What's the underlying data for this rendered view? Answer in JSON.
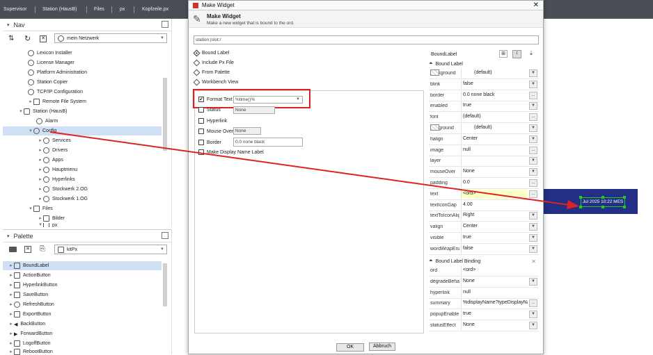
{
  "topbar": {
    "crumbs": [
      "Supervisor",
      "Station (HausB)",
      "Files",
      "px",
      "Kopfzeile.px"
    ]
  },
  "nav": {
    "title": "Nav",
    "network": "mein Netzwerk",
    "items": [
      "Lexicon Installer",
      "License Manager",
      "Platform Administration",
      "Station Copier",
      "TCP/IP Configuration",
      "Remote File System",
      "Station (HausB)",
      "Alarm",
      "Config",
      "Services",
      "Drivers",
      "Apps",
      "Hauptmenu",
      "Hyperlinks",
      "Stockwerk 2.OG",
      "Stockwerk 1.OG",
      "Files",
      "Bilder",
      "px"
    ]
  },
  "palette": {
    "title": "Palette",
    "module": "kitPx",
    "items": [
      "BoundLabel",
      "ActionButton",
      "HyperlinkButton",
      "SaveButton",
      "RefreshButton",
      "ExportButton",
      "BackButton",
      "ForwardButton",
      "LogoffButton",
      "RebootButton"
    ]
  },
  "dialog": {
    "title": "Make Widget",
    "heading": "Make Widget",
    "subheading": "Make a new widget that is bound to the ord.",
    "ord": "station:|slot:/",
    "options": [
      "Bound Label",
      "Include Px File",
      "From Palette",
      "Workbench View"
    ],
    "fields": {
      "format_text": {
        "label": "Format Text",
        "value": "%time()%"
      },
      "status": {
        "label": "Status",
        "value": "None"
      },
      "hyperlink": {
        "label": "Hyperlink"
      },
      "mouse_over": {
        "label": "Mouse Over",
        "value": "None"
      },
      "border": {
        "label": "Border",
        "value": "0.0 none black"
      },
      "make_display": {
        "label": "Make Display Name Label"
      }
    },
    "props_title": "BoundLabel",
    "section1": "Bound Label",
    "props": [
      {
        "k": "background",
        "v": "(default)"
      },
      {
        "k": "blink",
        "v": "false"
      },
      {
        "k": "border",
        "v": "0.0 none black"
      },
      {
        "k": "enabled",
        "v": "true"
      },
      {
        "k": "font",
        "v": "(default)"
      },
      {
        "k": "foreground",
        "v": "(default)"
      },
      {
        "k": "halign",
        "v": "Center"
      },
      {
        "k": "image",
        "v": "null"
      },
      {
        "k": "layer",
        "v": ""
      },
      {
        "k": "mouseOver",
        "v": "None"
      },
      {
        "k": "padding",
        "v": "0.0"
      },
      {
        "k": "text",
        "v": "<ord>"
      },
      {
        "k": "textIconGap",
        "v": "4.00"
      },
      {
        "k": "textToIconAlig",
        "v": "Right"
      },
      {
        "k": "valign",
        "v": "Center"
      },
      {
        "k": "visible",
        "v": "true"
      },
      {
        "k": "wordWrapEna",
        "v": "false"
      }
    ],
    "section2": "Bound Label Binding",
    "binding": [
      {
        "k": "ord",
        "v": "<ord>"
      },
      {
        "k": "degradeBehav",
        "v": "None"
      },
      {
        "k": "hyperlink",
        "v": "null"
      },
      {
        "k": "summary",
        "v": "%displayName?typeDisplayNa"
      },
      {
        "k": "popupEnable",
        "v": "true"
      },
      {
        "k": "statusEffect",
        "v": "None"
      }
    ],
    "ok": "OK",
    "cancel": "Abbruch"
  },
  "preview": {
    "text": "Jul 2025 10:22 MES"
  },
  "colors": {
    "highlight": "#dd2222",
    "canvas": "#232f85",
    "sel": "#cfe0f5",
    "handle": "#22cc22"
  }
}
